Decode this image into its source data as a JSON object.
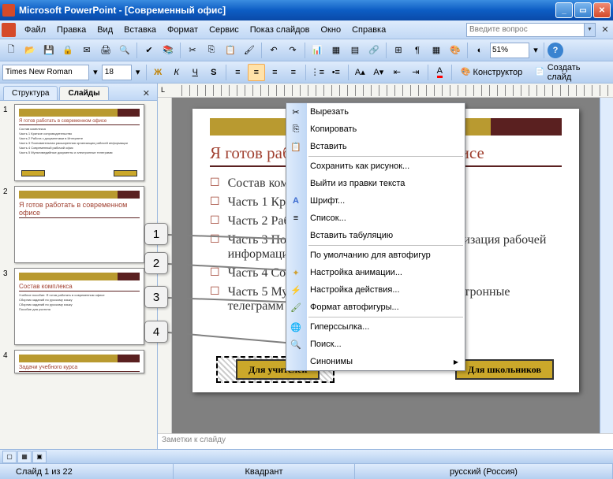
{
  "titlebar": {
    "text": "Microsoft PowerPoint - [Современный офис]"
  },
  "menubar": {
    "items": [
      "Файл",
      "Правка",
      "Вид",
      "Вставка",
      "Формат",
      "Сервис",
      "Показ слайдов",
      "Окно",
      "Справка"
    ],
    "question_placeholder": "Введите вопрос"
  },
  "toolbar": {
    "zoom": "51%"
  },
  "formatbar": {
    "font": "Times New Roman",
    "size": "18",
    "constructor": "Конструктор",
    "new_slide": "Создать слайд"
  },
  "left_tabs": {
    "tab1": "Структура",
    "tab2": "Слайды"
  },
  "thumbs": [
    {
      "num": "1",
      "title": "Я готов работать в современном офисе",
      "lines": [
        "Состав комплекса",
        "Часть 1 Краткое сопроводительство",
        "Часть 2 Работа с документами в Интернете",
        "Часть 3 Познавательная расширенная организация рабочей информации",
        "Часть 4 Современный рабочий офис",
        "Часть 5 Мультимедийные документы и электронные телеграмм"
      ]
    },
    {
      "num": "2",
      "title": "Я готов работать в современном офисе",
      "lines": [
        "…",
        "…",
        "…",
        "…"
      ]
    },
    {
      "num": "3",
      "title": "Состав комплекса",
      "lines": [
        "Учебное пособие: Я готов работать в современном офисе",
        "Сборник заданий по русскому языку",
        "Сборник заданий по русскому языку",
        "Пособие для учителя"
      ]
    },
    {
      "num": "4",
      "title": "Задачи учебного курса",
      "lines": []
    }
  ],
  "slide": {
    "title": "Я готов работать в современном офисе",
    "bullets": [
      "Состав комплекса",
      "Часть 1 Краткое сопроводительство",
      "Часть 2 Работа с документами в Интернете",
      "Часть 3 Познавательная расширенная организация рабочей информации",
      "Часть 4 Современный рабочий офис",
      "Часть 5 Мультимедийные документы и электронные телеграмм"
    ],
    "btn_left": "Для учителей",
    "btn_right": "Для школьников"
  },
  "context_menu": {
    "items": [
      {
        "icon": "cut-icon",
        "glyph": "✂",
        "label": "Вырезать"
      },
      {
        "icon": "copy-icon",
        "glyph": "⎘",
        "label": "Копировать"
      },
      {
        "icon": "paste-icon",
        "glyph": "📋",
        "label": "Вставить"
      },
      {
        "sep": true
      },
      {
        "icon": "",
        "glyph": "",
        "label": "Сохранить как рисунок..."
      },
      {
        "icon": "",
        "glyph": "",
        "label": "Выйти из правки текста"
      },
      {
        "icon": "font-icon",
        "glyph": "A",
        "label": "Шрифт..."
      },
      {
        "icon": "list-icon",
        "glyph": "≡",
        "label": "Список..."
      },
      {
        "icon": "",
        "glyph": "",
        "label": "Вставить табуляцию"
      },
      {
        "sep": true
      },
      {
        "icon": "",
        "glyph": "",
        "label": "По умолчанию для автофигур"
      },
      {
        "icon": "anim-icon",
        "glyph": "✦",
        "label": "Настройка анимации..."
      },
      {
        "icon": "action-icon",
        "glyph": "⚙",
        "label": "Настройка действия..."
      },
      {
        "icon": "format-icon",
        "glyph": "◆",
        "label": "Формат автофигуры..."
      },
      {
        "sep": true
      },
      {
        "icon": "link-icon",
        "glyph": "🌐",
        "label": "Гиперссылка..."
      },
      {
        "icon": "search-icon",
        "glyph": "🔍",
        "label": "Поиск..."
      },
      {
        "icon": "",
        "glyph": "",
        "label": "Синонимы",
        "submenu": true
      }
    ]
  },
  "callouts": [
    "1",
    "2",
    "3",
    "4"
  ],
  "notes": {
    "placeholder": "Заметки к слайду"
  },
  "statusbar": {
    "slide_pos": "Слайд 1 из 22",
    "layout": "Квадрант",
    "lang": "русский (Россия)"
  }
}
